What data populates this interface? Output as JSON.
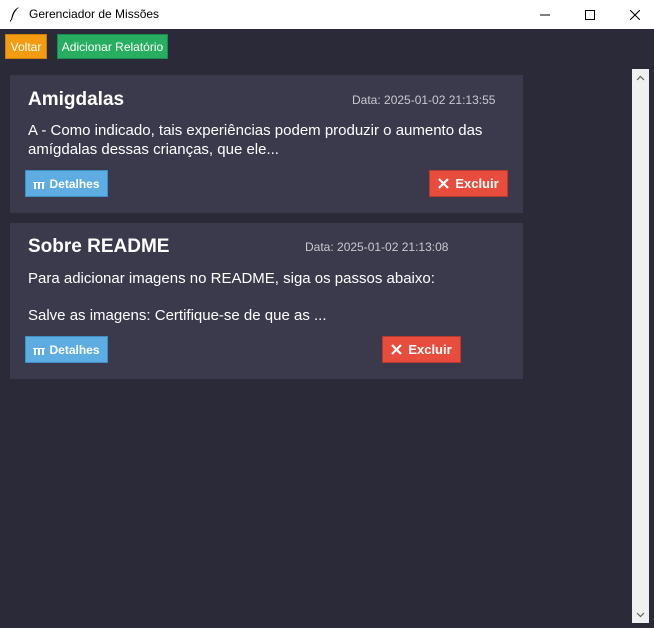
{
  "window": {
    "title": "Gerenciador de Missões",
    "app_icon": "feather-icon",
    "controls": [
      "minimize-icon",
      "maximize-icon",
      "close-icon"
    ]
  },
  "toolbar": {
    "back_label": "Voltar",
    "add_report_label": "Adicionar Relatório"
  },
  "reports": [
    {
      "title": "Amigdalas",
      "date": "Data: 2025-01-02 21:13:55",
      "preview_line1": "A - Como indicado, tais experiências podem produzir o aumento das",
      "preview_line2": "amígdalas dessas crianças, que ele...",
      "details_label": "Detalhes",
      "delete_label": "Excluir"
    },
    {
      "title": "Sobre README",
      "date": "Data: 2025-01-02 21:13:08",
      "preview_line1": "Para adicionar imagens no README, siga os passos abaixo:",
      "preview_line2": "Salve as imagens: Certifique-se de que as ...",
      "details_label": "Detalhes",
      "delete_label": "Excluir"
    }
  ],
  "colors": {
    "background": "#2b2a38",
    "card": "#3b3a4d",
    "back_button": "#f39c12",
    "add_button": "#27ae60",
    "details_button": "#5dade2",
    "delete_button": "#e74c3c"
  }
}
